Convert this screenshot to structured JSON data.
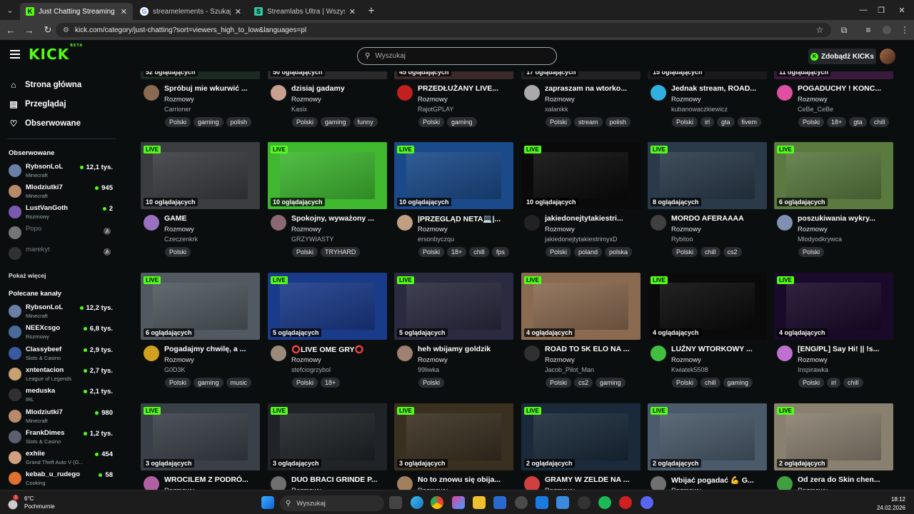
{
  "browser": {
    "tabs": [
      {
        "title": "Just Chatting Streaming - Live S",
        "active": true,
        "favicon": "K",
        "favicon_bg": "#53fc18"
      },
      {
        "title": "streamelements - Szukaj w Goo",
        "active": false,
        "favicon": "G",
        "favicon_bg": "#ffffff"
      },
      {
        "title": "Streamlabs Ultra | Wszystkie na",
        "active": false,
        "favicon": "S",
        "favicon_bg": "#31c3a2"
      }
    ],
    "url": "kick.com/category/just-chatting?sort=viewers_high_to_low&languages=pl"
  },
  "header": {
    "logo": "KICK",
    "logo_badge": "BETA",
    "search_placeholder": "Wyszukaj",
    "get_kicks": "Zdobądź KICKs"
  },
  "sidebar": {
    "nav": [
      {
        "label": "Strona główna",
        "icon": "home-icon",
        "glyph": "⌂"
      },
      {
        "label": "Przeglądaj",
        "icon": "browse-icon",
        "glyph": "▤"
      },
      {
        "label": "Obserwowane",
        "icon": "heart-icon",
        "glyph": "♡"
      }
    ],
    "followed_heading": "Obserwowane",
    "followed": [
      {
        "name": "RybsonLoL",
        "category": "Minecraft",
        "viewers": "12,1 tys.",
        "online": true,
        "color": "#6a7fa8"
      },
      {
        "name": "Mlodziutki7",
        "category": "Minecraft",
        "viewers": "945",
        "online": true,
        "color": "#b98a6a"
      },
      {
        "name": "LustVanGoth",
        "category": "Rozmowy",
        "viewers": "2",
        "online": true,
        "color": "#7a5ab0"
      },
      {
        "name": "Popo",
        "category": "",
        "viewers": "",
        "online": false,
        "color": "#dddddd"
      },
      {
        "name": "marekyt",
        "category": "",
        "viewers": "",
        "online": false,
        "color": "#555555"
      }
    ],
    "show_more": "Pokaż więcej",
    "recommended_heading": "Polecane kanały",
    "recommended": [
      {
        "name": "RybsonLoL",
        "category": "Minecraft",
        "viewers": "12,2 tys.",
        "color": "#6a7fa8"
      },
      {
        "name": "NEEXcsgo",
        "category": "Rozmowy",
        "viewers": "6,8 tys.",
        "color": "#4a6a9a"
      },
      {
        "name": "Classybeef",
        "category": "Slots & Casino",
        "viewers": "2,9 tys.",
        "color": "#3a5aa0"
      },
      {
        "name": "xntentacion",
        "category": "League of Legends",
        "viewers": "2,7 tys.",
        "color": "#c9a070"
      },
      {
        "name": "meduska",
        "category": "IRL",
        "viewers": "2,1 tys.",
        "color": "#303030"
      },
      {
        "name": "Mlodziutki7",
        "category": "Minecraft",
        "viewers": "980",
        "color": "#b98a6a"
      },
      {
        "name": "FrankDimes",
        "category": "Slots & Casino",
        "viewers": "1,2 tys.",
        "color": "#5a6070"
      },
      {
        "name": "exhiie",
        "category": "Grand Theft Auto V (G...",
        "viewers": "454",
        "color": "#d0a080"
      },
      {
        "name": "kebab_u_rudego",
        "category": "Cooking",
        "viewers": "58",
        "color": "#e07030"
      }
    ]
  },
  "streams": [
    {
      "viewers": "52 oglądających",
      "live": false,
      "title": "Spróbuj mie wkurwić ...",
      "category": "Rozmowy",
      "user": "Carrioner",
      "tags": [
        "Polski",
        "gaming",
        "polish"
      ],
      "thumb": "#1c2a22",
      "av": "#8a6a50"
    },
    {
      "viewers": "50 oglądających",
      "live": false,
      "title": "dzisiaj gadamy",
      "category": "Rozmowy",
      "user": "Kasix",
      "tags": [
        "Polski",
        "gaming",
        "funny"
      ],
      "thumb": "#2a2a2a",
      "av": "#c9a090"
    },
    {
      "viewers": "45 oglądających",
      "live": false,
      "title": "PRZEDŁUŻANY LIVE...",
      "category": "Rozmowy",
      "user": "RajotGPLAY",
      "tags": [
        "Polski",
        "gaming"
      ],
      "thumb": "#3a2a2a",
      "av": "#c02020"
    },
    {
      "viewers": "17 oglądających",
      "live": false,
      "title": "zapraszam na wtorko...",
      "category": "Rozmowy",
      "user": "xalanikk",
      "tags": [
        "Polski",
        "stream",
        "polish"
      ],
      "thumb": "#222",
      "av": "#aaaaaa"
    },
    {
      "viewers": "15 oglądających",
      "live": false,
      "title": "Jednak stream, ROAD...",
      "category": "Rozmowy",
      "user": "kubanowaczkiewicz",
      "tags": [
        "Polski",
        "irl",
        "gta",
        "fivem"
      ],
      "thumb": "#1a1a1a",
      "av": "#30b0e0"
    },
    {
      "viewers": "11 oglądających",
      "live": false,
      "title": "POGADUCHY ! KONC...",
      "category": "Rozmowy",
      "user": "CeBe_CeBe",
      "tags": [
        "Polski",
        "18+",
        "gta",
        "chill"
      ],
      "thumb": "#3a1a3a",
      "av": "#e050a0"
    },
    {
      "viewers": "10 oglądających",
      "live": true,
      "title": "GAME",
      "category": "Rozmowy",
      "user": "Czeczenkrk",
      "tags": [
        "Polski"
      ],
      "thumb": "#3a3c40",
      "av": "#9a70c0"
    },
    {
      "viewers": "10 oglądających",
      "live": true,
      "title": "Spokojny, wyważony ...",
      "category": "Rozmowy",
      "user": "GRZYWIASTY",
      "tags": [
        "Polski",
        "TRYHARD"
      ],
      "thumb": "#3fb830",
      "av": "#8a6a70"
    },
    {
      "viewers": "10 oglądających",
      "live": true,
      "title": "|PRZEGLĄD NETA💻|...",
      "category": "Rozmowy",
      "user": "ersonbyczqu",
      "tags": [
        "Polski",
        "18+",
        "chill",
        "fps"
      ],
      "thumb": "#1a4a8a",
      "av": "#c0a080"
    },
    {
      "viewers": "10 oglądających",
      "live": true,
      "title": "jakiedonejtytakiestri...",
      "category": "Rozmowy",
      "user": "jakiedonejtytakiestrimyxD",
      "tags": [
        "Polski",
        "poland",
        "polska"
      ],
      "thumb": "#0a0a0a",
      "av": "#222222"
    },
    {
      "viewers": "8 oglądających",
      "live": true,
      "title": "MORDO AFERAAAA",
      "category": "Rozmowy",
      "user": "Rybitoo",
      "tags": [
        "Polski",
        "chill",
        "cs2"
      ],
      "thumb": "#2a3a4a",
      "av": "#404040"
    },
    {
      "viewers": "6 oglądających",
      "live": true,
      "title": "poszukiwania wykry...",
      "category": "Rozmowy",
      "user": "Mlodyodkrywca",
      "tags": [
        "Polski"
      ],
      "thumb": "#5a7a40",
      "av": "#8090b0"
    },
    {
      "viewers": "6 oglądających",
      "live": true,
      "title": "Pogadajmy chwilę, a ...",
      "category": "Rozmowy",
      "user": "G0D3K",
      "tags": [
        "Polski",
        "gaming",
        "music"
      ],
      "thumb": "#505a60",
      "av": "#d0a020"
    },
    {
      "viewers": "5 oglądających",
      "live": true,
      "title": "⭕LIVE OME GRY⭕",
      "category": "Rozmowy",
      "user": "stefciogrzybol",
      "tags": [
        "Polski",
        "18+"
      ],
      "thumb": "#1a3a8a",
      "av": "#9a8a7a"
    },
    {
      "viewers": "5 oglądających",
      "live": true,
      "title": "heh wbijamy goldzik",
      "category": "Rozmowy",
      "user": "99liwka",
      "tags": [
        "Polski"
      ],
      "thumb": "#2a2a40",
      "av": "#a08070"
    },
    {
      "viewers": "4 oglądających",
      "live": true,
      "title": "ROAD TO 5K ELO NA ...",
      "category": "Rozmowy",
      "user": "Jacob_Pilot_Man",
      "tags": [
        "Polski",
        "cs2",
        "gaming"
      ],
      "thumb": "#8a6a50",
      "av": "#303030"
    },
    {
      "viewers": "4 oglądających",
      "live": true,
      "title": "LUŹNY WTORKOWY ...",
      "category": "Rozmowy",
      "user": "Kwiatek5508",
      "tags": [
        "Polski",
        "chill",
        "gaming"
      ],
      "thumb": "#0a0a0a",
      "av": "#40c040"
    },
    {
      "viewers": "4 oglądających",
      "live": true,
      "title": "[ENG/PL] Say Hi! || !s...",
      "category": "Rozmowy",
      "user": "Inspirawka",
      "tags": [
        "Polski",
        "irl",
        "chill"
      ],
      "thumb": "#1a0a2a",
      "av": "#c070d0"
    },
    {
      "viewers": "3 oglądających",
      "live": true,
      "title": "WROCILEM Z PODRÓ...",
      "category": "Rozmowy",
      "user": "",
      "tags": [],
      "thumb": "#3a4048",
      "av": "#b060a0"
    },
    {
      "viewers": "3 oglądających",
      "live": true,
      "title": "DUO BRACI GRINDE P...",
      "category": "Rozmowy",
      "user": "",
      "tags": [],
      "thumb": "#202428",
      "av": "#707070"
    },
    {
      "viewers": "3 oglądających",
      "live": true,
      "title": "No to znowu się obija...",
      "category": "Rozmowy",
      "user": "",
      "tags": [],
      "thumb": "#3a3020",
      "av": "#a08060"
    },
    {
      "viewers": "2 oglądających",
      "live": true,
      "title": "GRAMY W ZELDE NA ...",
      "category": "Rozmowy",
      "user": "",
      "tags": [],
      "thumb": "#1a2a3a",
      "av": "#d04040"
    },
    {
      "viewers": "2 oglądających",
      "live": true,
      "title": "Wbijać pogadać 💪 G...",
      "category": "Rozmowy",
      "user": "",
      "tags": [],
      "thumb": "#4a5a6a",
      "av": "#707070"
    },
    {
      "viewers": "2 oglądających",
      "live": true,
      "title": "Od zera do Skin chen...",
      "category": "Rozmowy",
      "user": "",
      "tags": [],
      "thumb": "#8a8070",
      "av": "#40a040"
    }
  ],
  "live_label": "LIVE",
  "taskbar": {
    "temp": "6°C",
    "weather": "Pochmurnie",
    "search": "Wyszukaj",
    "time": "18:12",
    "date": "24.02.2026"
  }
}
